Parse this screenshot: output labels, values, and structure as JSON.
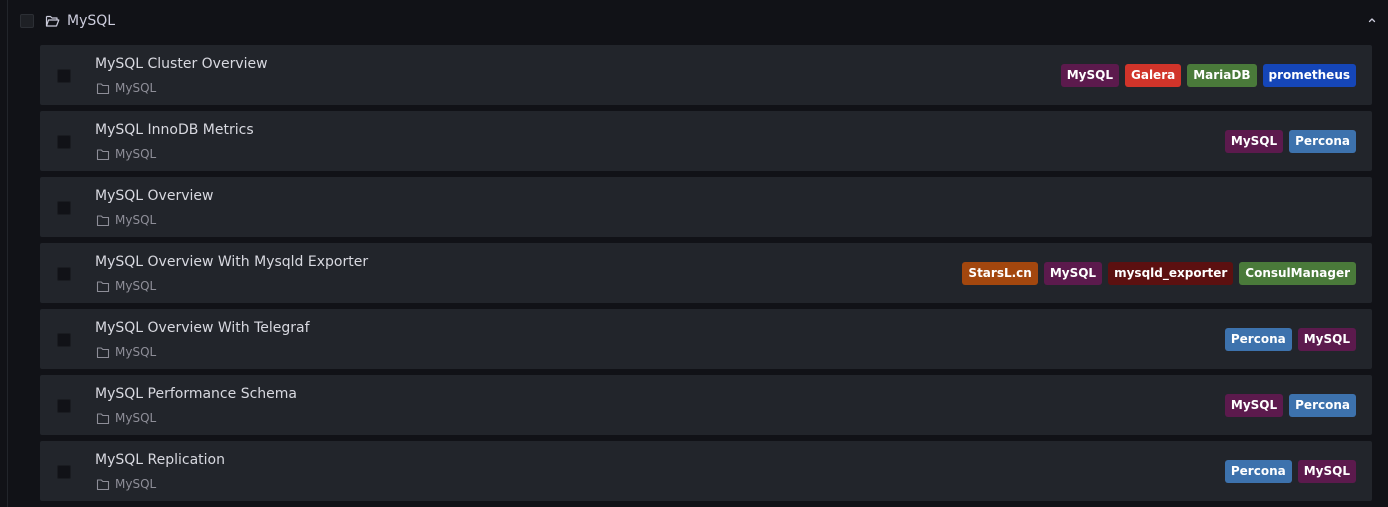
{
  "folder": {
    "title": "MySQL"
  },
  "rows": [
    {
      "title": "MySQL Cluster Overview",
      "location": "MySQL",
      "tags": [
        {
          "label": "MySQL",
          "color": "#5c1a4d"
        },
        {
          "label": "Galera",
          "color": "#d1342a"
        },
        {
          "label": "MariaDB",
          "color": "#4a7a3a"
        },
        {
          "label": "prometheus",
          "color": "#1546b8"
        }
      ]
    },
    {
      "title": "MySQL InnoDB Metrics",
      "location": "MySQL",
      "tags": [
        {
          "label": "MySQL",
          "color": "#5c1a4d"
        },
        {
          "label": "Percona",
          "color": "#3d72ad"
        }
      ]
    },
    {
      "title": "MySQL Overview",
      "location": "MySQL",
      "tags": []
    },
    {
      "title": "MySQL Overview With Mysqld Exporter",
      "location": "MySQL",
      "tags": [
        {
          "label": "StarsL.cn",
          "color": "#a3470e"
        },
        {
          "label": "MySQL",
          "color": "#5c1a4d"
        },
        {
          "label": "mysqld_exporter",
          "color": "#5c1010"
        },
        {
          "label": "ConsulManager",
          "color": "#4a7a3a"
        }
      ]
    },
    {
      "title": "MySQL Overview With Telegraf",
      "location": "MySQL",
      "tags": [
        {
          "label": "Percona",
          "color": "#3d72ad"
        },
        {
          "label": "MySQL",
          "color": "#5c1a4d"
        }
      ]
    },
    {
      "title": "MySQL Performance Schema",
      "location": "MySQL",
      "tags": [
        {
          "label": "MySQL",
          "color": "#5c1a4d"
        },
        {
          "label": "Percona",
          "color": "#3d72ad"
        }
      ]
    },
    {
      "title": "MySQL Replication",
      "location": "MySQL",
      "tags": [
        {
          "label": "Percona",
          "color": "#3d72ad"
        },
        {
          "label": "MySQL",
          "color": "#5c1a4d"
        }
      ]
    }
  ]
}
